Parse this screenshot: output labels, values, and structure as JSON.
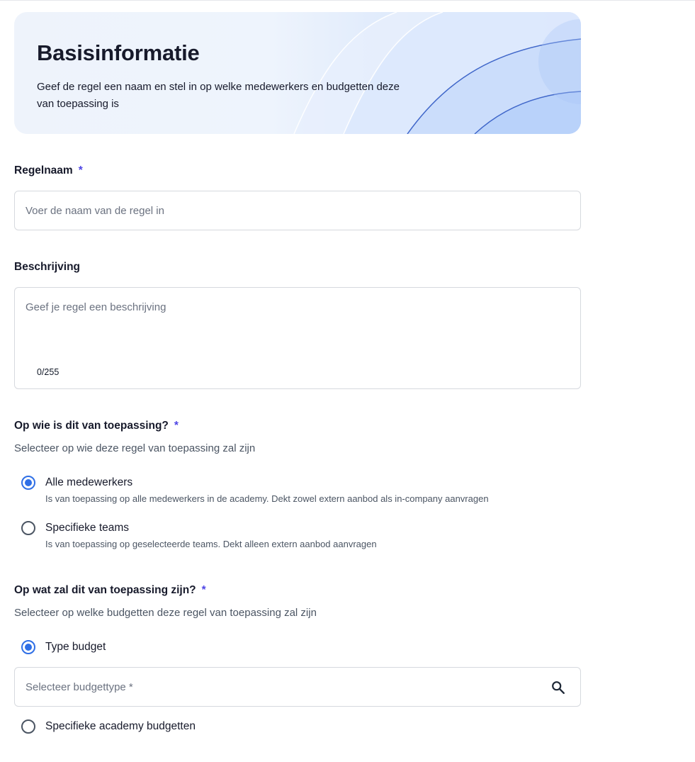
{
  "header": {
    "title": "Basisinformatie",
    "subtitle": "Geef de regel een naam en stel in op welke medewerkers en budgetten deze van toepassing is"
  },
  "rule_name": {
    "label": "Regelnaam",
    "required_mark": "*",
    "placeholder": "Voer de naam van de regel in",
    "value": ""
  },
  "description": {
    "label": "Beschrijving",
    "placeholder": "Geef je regel een beschrijving",
    "counter": "0/255",
    "value": ""
  },
  "applies_to": {
    "label": "Op wie is dit van toepassing?",
    "required_mark": "*",
    "help": "Selecteer op wie deze regel van toepassing zal zijn",
    "options": [
      {
        "label": "Alle medewerkers",
        "description": "Is van toepassing op alle medewerkers in de academy. Dekt zowel extern aanbod als in-company aanvragen",
        "selected": true
      },
      {
        "label": "Specifieke teams",
        "description": "Is van toepassing op geselecteerde teams. Dekt alleen extern aanbod aanvragen",
        "selected": false
      }
    ]
  },
  "budgets": {
    "label": "Op wat zal dit van toepassing zijn?",
    "required_mark": "*",
    "help": "Selecteer op welke budgetten deze regel van toepassing zal zijn",
    "options": [
      {
        "label": "Type budget",
        "selected": true
      },
      {
        "label": "Specifieke academy budgetten",
        "selected": false
      }
    ],
    "budget_type_placeholder": "Selecteer budgettype *",
    "search_icon": "search-icon"
  },
  "colors": {
    "accent": "#2f6fe6",
    "required": "#4f46e5",
    "hero_curve": "#3f66c9"
  }
}
